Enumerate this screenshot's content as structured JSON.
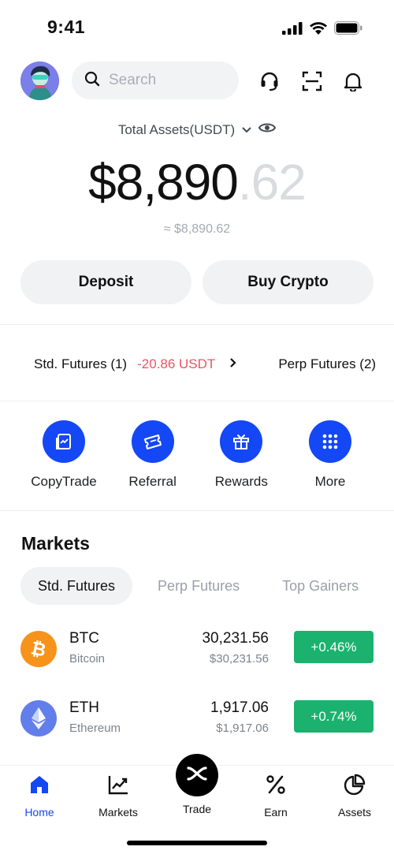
{
  "status_bar": {
    "time": "9:41"
  },
  "header": {
    "search_placeholder": "Search"
  },
  "balance": {
    "label": "Total Assets(USDT)",
    "integer": "$8,890",
    "decimal": ".62",
    "approx": "≈ $8,890.62"
  },
  "actions": {
    "deposit": "Deposit",
    "buy_crypto": "Buy Crypto"
  },
  "futures_strip": [
    {
      "label": "Std. Futures (1)",
      "pnl": "-20.86 USDT"
    },
    {
      "label": "Perp Futures (2)"
    }
  ],
  "quick_actions": [
    {
      "label": "CopyTrade",
      "icon": "copytrade-icon"
    },
    {
      "label": "Referral",
      "icon": "ticket-icon"
    },
    {
      "label": "Rewards",
      "icon": "gift-icon"
    },
    {
      "label": "More",
      "icon": "grid-dots-icon"
    }
  ],
  "markets": {
    "title": "Markets",
    "tabs": [
      "Std. Futures",
      "Perp Futures",
      "Top Gainers"
    ],
    "active_tab": "Std. Futures",
    "rows": [
      {
        "symbol": "BTC",
        "name": "Bitcoin",
        "price": "30,231.56",
        "usd": "$30,231.56",
        "change": "+0.46%",
        "logo_color": "#f7931a"
      },
      {
        "symbol": "ETH",
        "name": "Ethereum",
        "price": "1,917.06",
        "usd": "$1,917.06",
        "change": "+0.74%",
        "logo_color": "#627eea"
      }
    ]
  },
  "bottom_nav": {
    "items": [
      "Home",
      "Markets",
      "Trade",
      "Earn",
      "Assets"
    ],
    "active": "Home"
  },
  "colors": {
    "accent": "#1447f5",
    "positive": "#1ab26e",
    "negative": "#ef5261"
  }
}
